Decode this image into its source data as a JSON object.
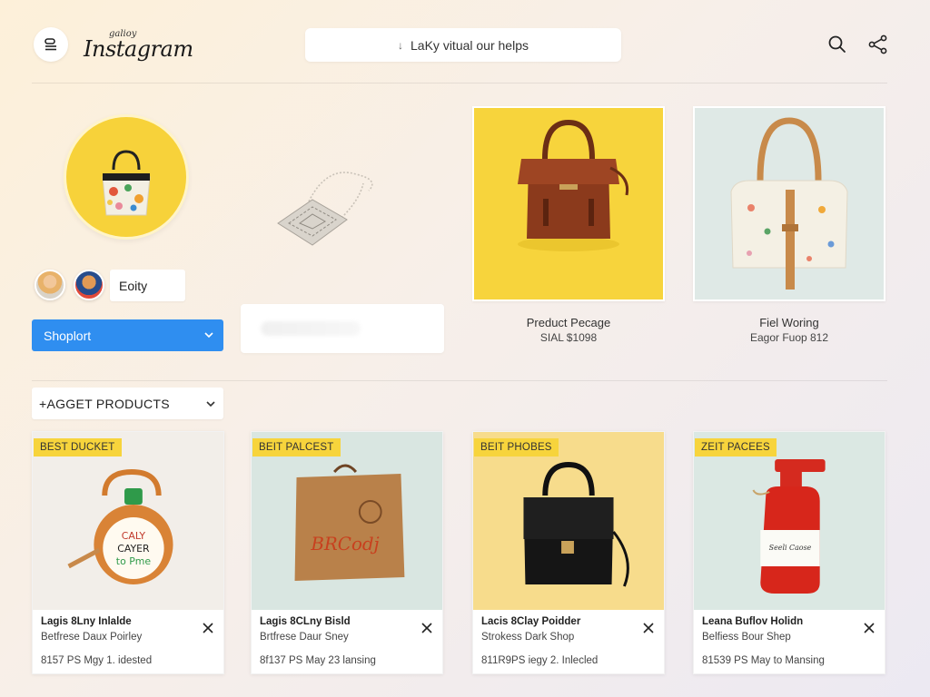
{
  "header": {
    "menu_icon": "menu-icon",
    "logo_small": "galioy",
    "logo": "Instagram",
    "search_glyph": "↓",
    "search_text": "LaKy vitual our helps",
    "search_icon": "search-icon",
    "share_icon": "share-icon"
  },
  "profile": {
    "entry_value": "Eoity",
    "shop_select": "Shoplort"
  },
  "featured": [
    {
      "label": "Preduct Pecage",
      "sub": "SIAL $1098"
    },
    {
      "label": "Fiel Woring",
      "sub": "Eagor Fuop 812"
    }
  ],
  "target": {
    "select_label": "+AGGET PRODUCTS"
  },
  "products": [
    {
      "badge": "BEST DUCKET",
      "title": "Lagis 8Lny Inlalde",
      "subtitle": "Betfrese Daux Poirley",
      "meta": "8157 PS Mgy 1. idested"
    },
    {
      "badge": "BEIT PALCEST",
      "title": "Lagis 8CLny Bisld",
      "subtitle": "Brtfrese Daur Sney",
      "meta": "8f137 PS May 23 lansing"
    },
    {
      "badge": "BEIT PHOBES",
      "title": "Lacis 8Clay Poidder",
      "subtitle": "Strokess Dark Shop",
      "meta": "811R9PS iegy 2. Inlecled"
    },
    {
      "badge": "ZEIT PACEES",
      "title": "Leana Buflov Holidn",
      "subtitle": "Belfiess Bour Shep",
      "meta": "81539 PS May to Mansing"
    }
  ],
  "colors": {
    "accent_blue": "#2f8ef0",
    "badge_yellow": "#f7d43c"
  }
}
